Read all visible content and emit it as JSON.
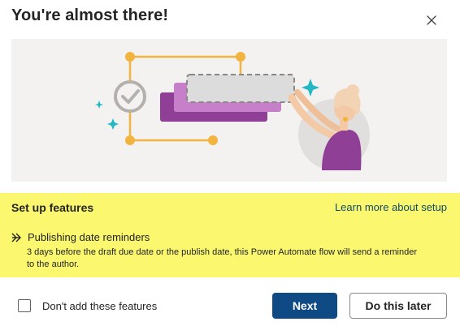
{
  "dialog": {
    "title": "You're almost there!",
    "close_icon": "close-icon"
  },
  "hero": {
    "illustration": "setup-illustration"
  },
  "features": {
    "heading": "Set up features",
    "learn_more": "Learn more about setup",
    "items": [
      {
        "icon": "double-chevron-right-icon",
        "name": "Publishing date reminders",
        "description": "3 days before the draft due date or the publish date, this Power Automate flow will send a reminder to the author."
      }
    ],
    "highlight_color": "#fbf86f"
  },
  "footer": {
    "checkbox_label": "Don't add these features",
    "checkbox_checked": false,
    "next_label": "Next",
    "later_label": "Do this later",
    "primary_color": "#0f4a85"
  }
}
